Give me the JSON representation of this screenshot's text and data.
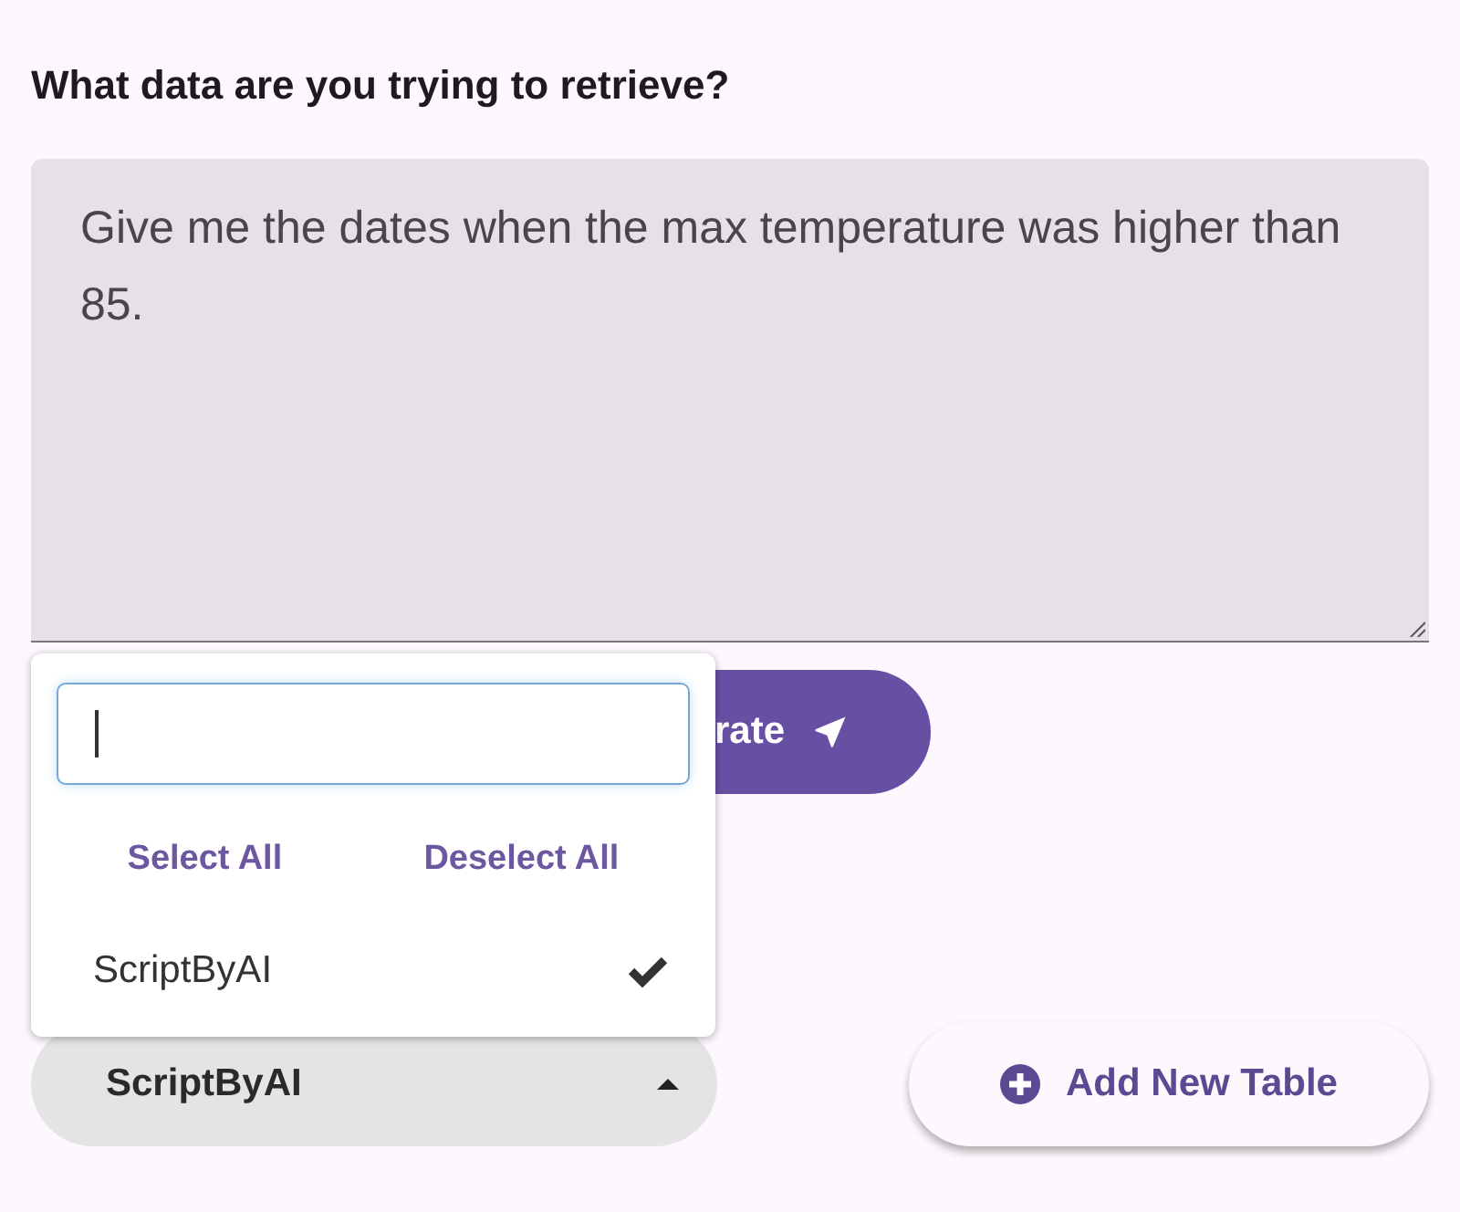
{
  "heading": "What data are you trying to retrieve?",
  "query": {
    "value": "Give me the dates when the max temperature was higher than 85."
  },
  "generate_button": {
    "label": "rate"
  },
  "table_dropdown": {
    "value": "ScriptByAI",
    "expanded": true,
    "actions": [
      "Select All",
      "Deselect All"
    ],
    "options": [
      {
        "label": "ScriptByAI",
        "selected": true
      }
    ]
  },
  "add_table_button": {
    "label": "Add New Table"
  }
}
